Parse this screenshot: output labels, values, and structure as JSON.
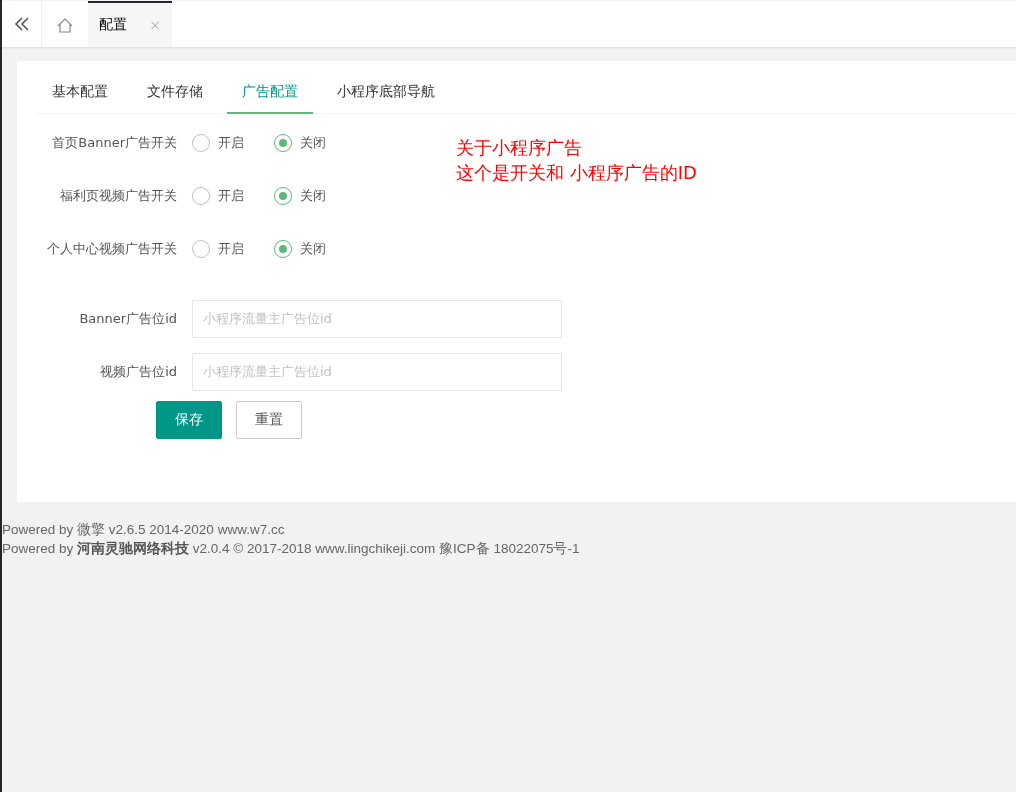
{
  "top_tabs": [
    {
      "kind": "home",
      "selected": false
    },
    {
      "kind": "page",
      "label": "配置",
      "close": "×",
      "selected": true
    }
  ],
  "sub_tabs": [
    {
      "label": "基本配置",
      "selected": false
    },
    {
      "label": "文件存储",
      "selected": false
    },
    {
      "label": "广告配置",
      "selected": true
    },
    {
      "label": "小程序底部导航",
      "selected": false
    }
  ],
  "switches": [
    {
      "label": "首页Banner广告开关",
      "options": [
        {
          "label": "开启",
          "selected": false
        },
        {
          "label": "关闭",
          "selected": true
        }
      ]
    },
    {
      "label": "福利页视频广告开关",
      "options": [
        {
          "label": "开启",
          "selected": false
        },
        {
          "label": "关闭",
          "selected": true
        }
      ]
    },
    {
      "label": "个人中心视频广告开关",
      "options": [
        {
          "label": "开启",
          "selected": false
        },
        {
          "label": "关闭",
          "selected": true
        }
      ]
    }
  ],
  "fields": [
    {
      "label": "Banner广告位id",
      "placeholder": "小程序流量主广告位id"
    },
    {
      "label": "视频广告位id",
      "placeholder": "小程序流量主广告位id"
    }
  ],
  "buttons": [
    {
      "kind": "primary",
      "label": "保存"
    },
    {
      "kind": "plain",
      "label": "重置"
    }
  ],
  "annotation": [
    "关于小程序广告",
    "这个是开关和 小程序广告的ID"
  ],
  "footer": [
    "Powered by 微擎 v2.6.5 2014-2020 www.w7.cc",
    "Powered by **河南灵驰网络科技** v2.0.4 © 2017-2018 www.lingchikeji.com 豫ICP备 18022075号-1"
  ]
}
